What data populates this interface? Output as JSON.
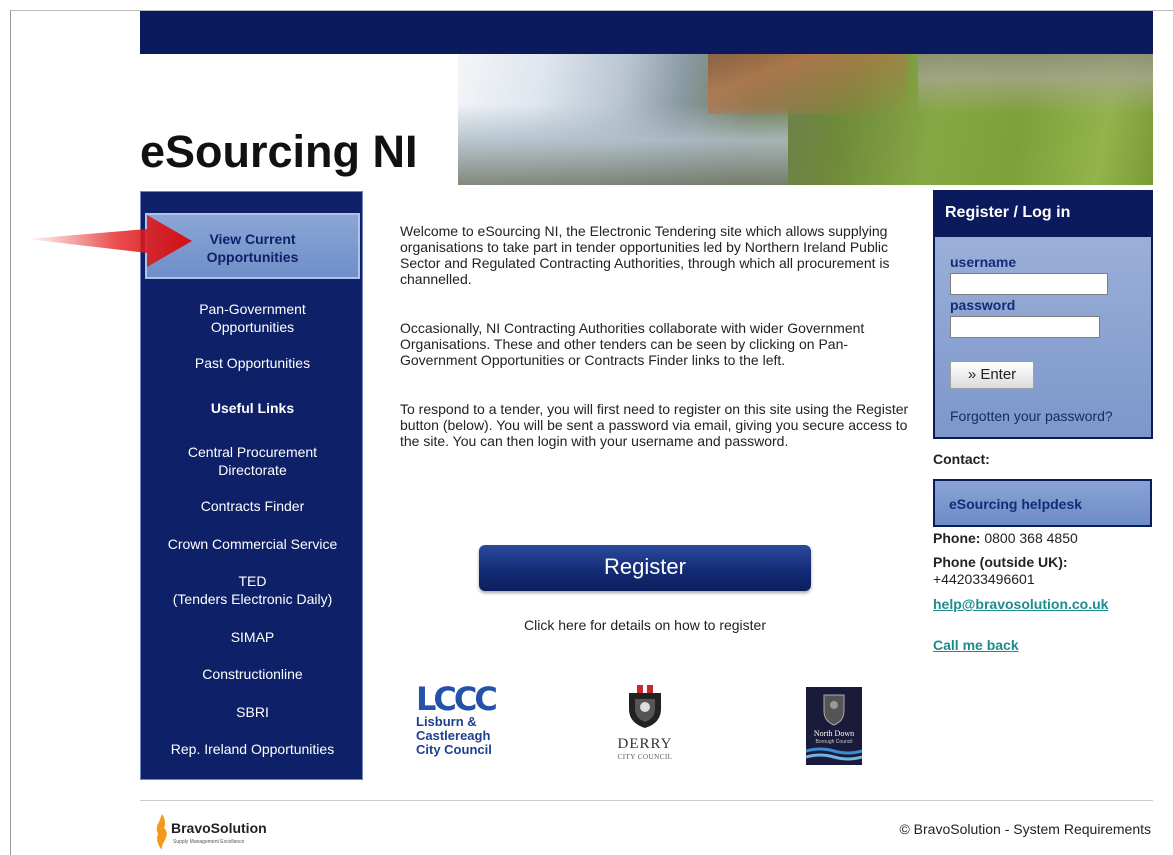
{
  "header": {
    "site_title": "eSourcing NI"
  },
  "sidebar": {
    "current": {
      "line1": "View Current",
      "line2": "Opportunities"
    },
    "items": [
      {
        "line1": "Pan-Government",
        "line2": "Opportunities"
      },
      {
        "label": "Past Opportunities"
      },
      {
        "label": "Useful Links"
      },
      {
        "line1": "Central Procurement",
        "line2": "Directorate"
      },
      {
        "label": "Contracts Finder"
      },
      {
        "label": "Crown Commercial Service"
      },
      {
        "line1": "TED",
        "line2": "(Tenders Electronic Daily)"
      },
      {
        "label": "SIMAP"
      },
      {
        "label": "Constructionline"
      },
      {
        "label": "SBRI"
      },
      {
        "label": "Rep. Ireland Opportunities"
      }
    ]
  },
  "main": {
    "paragraphs": [
      "Welcome to eSourcing NI, the Electronic Tendering site which allows supplying organisations to take part in tender opportunities led by Northern Ireland Public Sector and Regulated Contracting Authorities, through which all procurement is channelled.",
      "Occasionally, NI Contracting Authorities collaborate with wider Government Organisations. These and other tenders can be seen by clicking on Pan-Government Opportunities or Contracts Finder links to the left.",
      "To respond to a tender, you will first need to register on this site using the Register button (below). You will be sent a password via email, giving you secure access to the site. You can then login with your username and password."
    ],
    "register_label": "Register",
    "register_help": "Click here for details on how to register",
    "logos": {
      "lccc_mark": "LCCC",
      "lccc_line1": "Lisburn &",
      "lccc_line2": "Castlereagh",
      "lccc_line3": "City Council",
      "derry_name": "DERRY",
      "derry_sub": "CITY COUNCIL",
      "northdown_name": "North Down",
      "northdown_sub": "Borough Council"
    }
  },
  "login": {
    "title": "Register / Log in",
    "username_label": "username",
    "password_label": "password",
    "username_value": "",
    "password_value": "",
    "enter_label": "» Enter",
    "forgot_label": "Forgotten your password?"
  },
  "contact": {
    "label": "Contact:",
    "helpdesk": "eSourcing helpdesk",
    "phone_label": "Phone:",
    "phone_value": "0800 368 4850",
    "phone_outside_label": "Phone (outside UK):",
    "phone_outside_value": "+442033496601",
    "email": "help@bravosolution.co.uk",
    "callback": "Call me back"
  },
  "footer": {
    "brand": "BravoSolution",
    "tagline": "Supply Management Excellence",
    "copyright": "© BravoSolution - System Requirements"
  },
  "colors": {
    "navy": "#0a1a5c",
    "sidebar_blue": "#0e2068",
    "panel_blue": "#7d97cb",
    "link_teal": "#1c8c8c",
    "arrow_red": "#e41e20"
  }
}
